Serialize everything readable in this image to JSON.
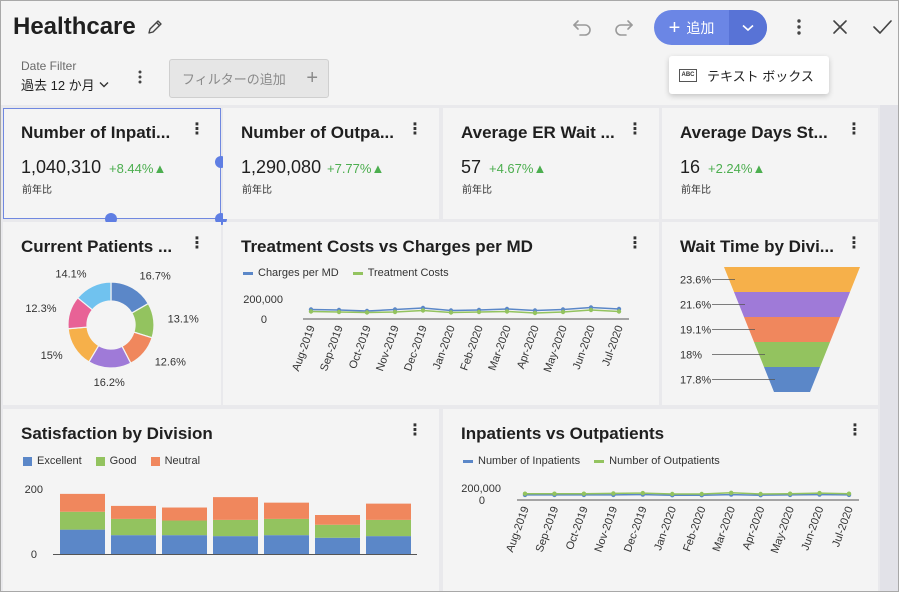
{
  "header": {
    "title": "Healthcare",
    "add_label": "追加",
    "popup_label": "テキスト ボックス",
    "popup_icon_text": "ABC",
    "icons": [
      "edit-icon",
      "undo-icon",
      "redo-icon",
      "chevron-down-icon",
      "more-vertical-icon",
      "close-icon",
      "check-icon"
    ]
  },
  "filter": {
    "date_filter_label": "Date Filter",
    "date_filter_value": "過去 12 か月",
    "add_filter_label": "フィルターの追加"
  },
  "kpis": [
    {
      "title": "Number of Inpati...",
      "value": "1,040,310",
      "change": "+8.44%▲",
      "sub": "前年比"
    },
    {
      "title": "Number of Outpa...",
      "value": "1,290,080",
      "change": "+7.77%▲",
      "sub": "前年比"
    },
    {
      "title": "Average ER Wait ...",
      "value": "57",
      "change": "+4.67%▲",
      "sub": "前年比"
    },
    {
      "title": "Average Days St...",
      "value": "16",
      "change": "+2.24%▲",
      "sub": "前年比"
    }
  ],
  "colors": {
    "accent": "#6b86e5",
    "positive": "#4cae4f",
    "blue": "#5b87c8",
    "green": "#93c35f",
    "orange": "#f0875d",
    "purple": "#9f7ad8",
    "yellow": "#f6b04a",
    "pink": "#e86296",
    "sky": "#70c2ef"
  },
  "tiles": {
    "current_patients": {
      "title": "Current Patients ..."
    },
    "treatment_costs": {
      "title": "Treatment Costs vs Charges per MD"
    },
    "wait_time": {
      "title": "Wait Time by Divi..."
    },
    "satisfaction": {
      "title": "Satisfaction by Division"
    },
    "inpatients_outpatients": {
      "title": "Inpatients vs Outpatients"
    }
  },
  "chart_data": [
    {
      "type": "pie",
      "title": "Current Patients ...",
      "values": [
        16.7,
        13.1,
        12.6,
        16.2,
        15,
        12.3,
        14.1
      ],
      "labels": [
        "16.7%",
        "13.1%",
        "12.6%",
        "16.2%",
        "15%",
        "12.3%",
        "14.1%"
      ],
      "colors": [
        "#5b87c8",
        "#93c35f",
        "#f0875d",
        "#9f7ad8",
        "#f6b04a",
        "#e86296",
        "#70c2ef"
      ]
    },
    {
      "type": "line",
      "title": "Treatment Costs vs Charges per MD",
      "categories": [
        "Aug-2019",
        "Sep-2019",
        "Oct-2019",
        "Nov-2019",
        "Dec-2019",
        "Jan-2020",
        "Feb-2020",
        "Mar-2020",
        "Apr-2020",
        "May-2020",
        "Jun-2020",
        "Jul-2020"
      ],
      "series": [
        {
          "name": "Charges per MD",
          "color": "#5b87c8",
          "values": [
            95000,
            90000,
            80000,
            95000,
            110000,
            85000,
            90000,
            100000,
            85000,
            95000,
            115000,
            100000
          ]
        },
        {
          "name": "Treatment Costs",
          "color": "#93c35f",
          "values": [
            75000,
            70000,
            65000,
            70000,
            85000,
            65000,
            70000,
            75000,
            60000,
            70000,
            90000,
            75000
          ]
        }
      ],
      "yticks": [
        "200,000",
        "0"
      ],
      "ylim": [
        0,
        200000
      ]
    },
    {
      "type": "bar",
      "subtype": "funnel",
      "title": "Wait Time by Divi...",
      "values": [
        23.6,
        21.6,
        19.1,
        18,
        17.8
      ],
      "labels": [
        "23.6%",
        "21.6%",
        "19.1%",
        "18%",
        "17.8%"
      ],
      "colors": [
        "#f6b04a",
        "#9f7ad8",
        "#f0875d",
        "#93c35f",
        "#5b87c8"
      ]
    },
    {
      "type": "bar",
      "subtype": "stacked",
      "title": "Satisfaction by Division",
      "categories": [
        "",
        "",
        "",
        "",
        "",
        "",
        ""
      ],
      "series": [
        {
          "name": "Excellent",
          "color": "#5b87c8",
          "values": [
            75,
            58,
            58,
            55,
            58,
            50,
            55
          ]
        },
        {
          "name": "Good",
          "color": "#93c35f",
          "values": [
            55,
            50,
            45,
            50,
            50,
            40,
            50
          ]
        },
        {
          "name": "Neutral",
          "color": "#f0875d",
          "values": [
            55,
            40,
            40,
            70,
            50,
            30,
            50
          ]
        }
      ],
      "yticks": [
        "200",
        "0"
      ],
      "ylim": [
        0,
        200
      ]
    },
    {
      "type": "line",
      "title": "Inpatients vs Outpatients",
      "categories": [
        "Aug-2019",
        "Sep-2019",
        "Oct-2019",
        "Nov-2019",
        "Dec-2019",
        "Jan-2020",
        "Feb-2020",
        "Mar-2020",
        "Apr-2020",
        "May-2020",
        "Jun-2020",
        "Jul-2020"
      ],
      "series": [
        {
          "name": "Number of Inpatients",
          "color": "#5b87c8",
          "values": [
            85000,
            85000,
            85000,
            85000,
            90000,
            80000,
            80000,
            90000,
            80000,
            85000,
            90000,
            85000
          ]
        },
        {
          "name": "Number of Outpatients",
          "color": "#93c35f",
          "values": [
            105000,
            105000,
            105000,
            110000,
            115000,
            100000,
            100000,
            120000,
            100000,
            105000,
            115000,
            105000
          ]
        }
      ],
      "yticks": [
        "200,000",
        "0"
      ],
      "ylim": [
        0,
        200000
      ]
    }
  ]
}
